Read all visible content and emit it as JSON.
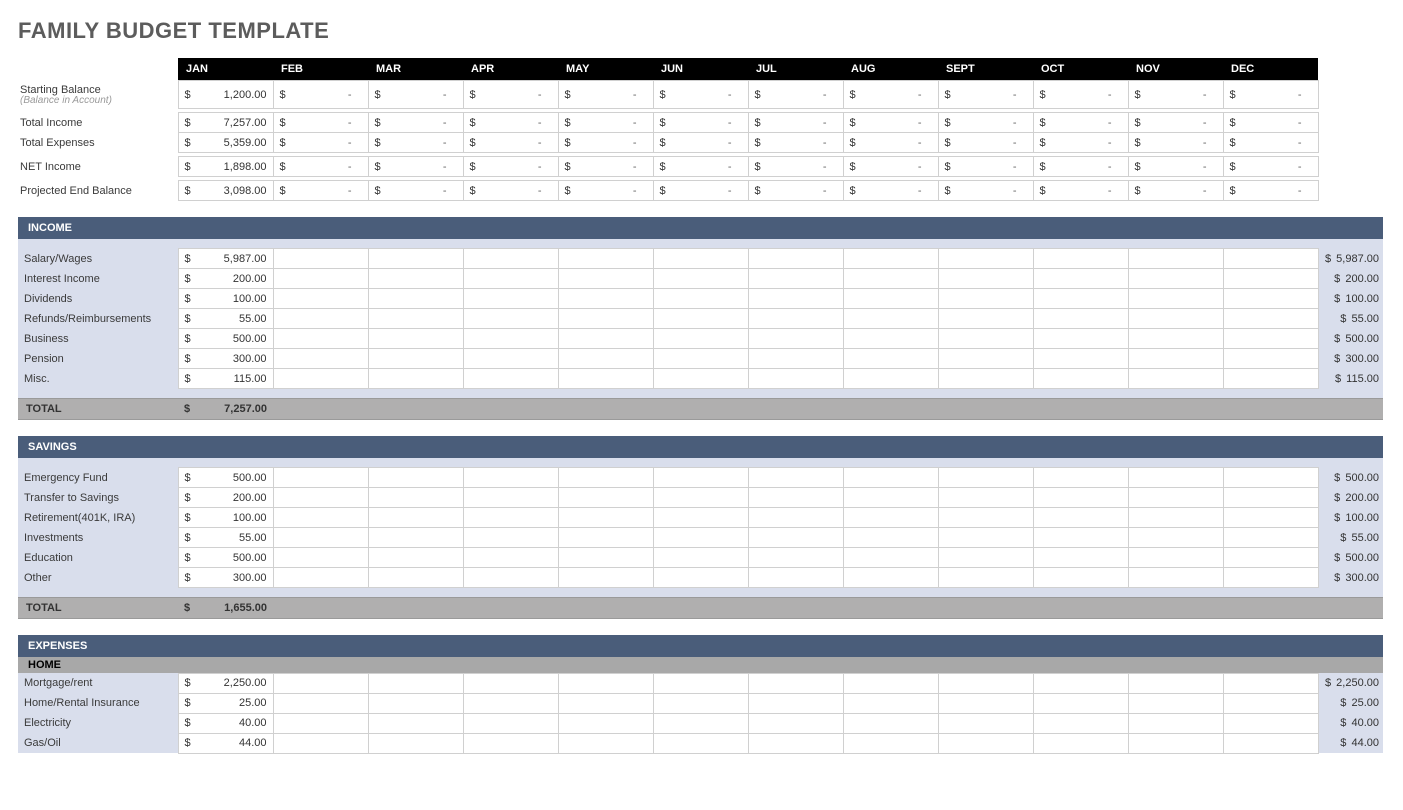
{
  "title": "FAMILY BUDGET TEMPLATE",
  "months": [
    "JAN",
    "FEB",
    "MAR",
    "APR",
    "MAY",
    "JUN",
    "JUL",
    "AUG",
    "SEPT",
    "OCT",
    "NOV",
    "DEC"
  ],
  "summary": {
    "rows": [
      {
        "label": "Starting Balance",
        "sub": "(Balance in Account)",
        "jan": "1,200.00"
      },
      {
        "label": "Total Income",
        "jan": "7,257.00"
      },
      {
        "label": "Total Expenses",
        "jan": "5,359.00"
      },
      {
        "label": "NET Income",
        "jan": "1,898.00"
      },
      {
        "label": "Projected End Balance",
        "jan": "3,098.00"
      }
    ]
  },
  "sections": [
    {
      "heading": "INCOME",
      "rows": [
        {
          "label": "Salary/Wages",
          "jan": "5,987.00",
          "total": "5,987.00"
        },
        {
          "label": "Interest Income",
          "jan": "200.00",
          "total": "200.00"
        },
        {
          "label": "Dividends",
          "jan": "100.00",
          "total": "100.00"
        },
        {
          "label": "Refunds/Reimbursements",
          "jan": "55.00",
          "total": "55.00"
        },
        {
          "label": "Business",
          "jan": "500.00",
          "total": "500.00"
        },
        {
          "label": "Pension",
          "jan": "300.00",
          "total": "300.00"
        },
        {
          "label": "Misc.",
          "jan": "115.00",
          "total": "115.00"
        }
      ],
      "total_label": "TOTAL",
      "total_jan": "7,257.00"
    },
    {
      "heading": "SAVINGS",
      "rows": [
        {
          "label": "Emergency Fund",
          "jan": "500.00",
          "total": "500.00"
        },
        {
          "label": "Transfer to Savings",
          "jan": "200.00",
          "total": "200.00"
        },
        {
          "label": "Retirement(401K, IRA)",
          "jan": "100.00",
          "total": "100.00"
        },
        {
          "label": "Investments",
          "jan": "55.00",
          "total": "55.00"
        },
        {
          "label": "Education",
          "jan": "500.00",
          "total": "500.00"
        },
        {
          "label": "Other",
          "jan": "300.00",
          "total": "300.00"
        }
      ],
      "total_label": "TOTAL",
      "total_jan": "1,655.00"
    },
    {
      "heading": "EXPENSES",
      "subheading": "HOME",
      "rows": [
        {
          "label": "Mortgage/rent",
          "jan": "2,250.00",
          "total": "2,250.00"
        },
        {
          "label": "Home/Rental Insurance",
          "jan": "25.00",
          "total": "25.00"
        },
        {
          "label": "Electricity",
          "jan": "40.00",
          "total": "40.00"
        },
        {
          "label": "Gas/Oil",
          "jan": "44.00",
          "total": "44.00"
        }
      ]
    }
  ]
}
